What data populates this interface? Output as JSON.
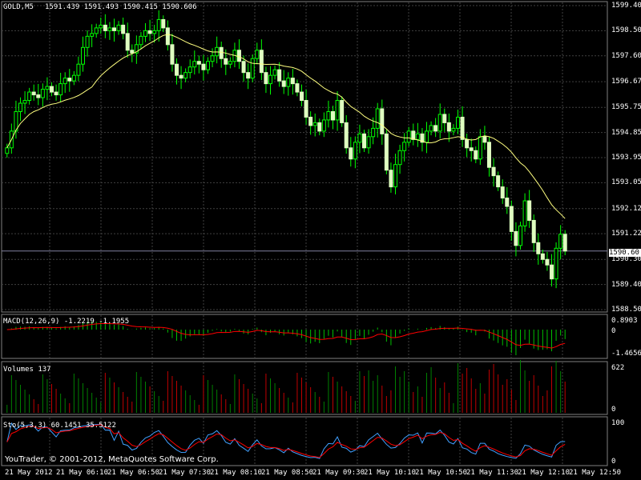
{
  "chart": {
    "symbol_header": "GOLD,M5",
    "ohlc_header": "1591.439 1591.493 1590.415 1590.606",
    "current_price_label": "1590.60",
    "price_axis_labels": [
      "1599.40",
      "1598.50",
      "1597.60",
      "1596.67",
      "1595.75",
      "1594.85",
      "1593.95",
      "1593.05",
      "1592.12",
      "1591.22",
      "1590.30",
      "1589.40",
      "1588.50"
    ],
    "time_axis_labels": [
      "21 May 2012",
      "21 May 06:10",
      "21 May 06:50",
      "21 May 07:30",
      "21 May 08:10",
      "21 May 08:50",
      "21 May 09:30",
      "21 May 10:10",
      "21 May 10:50",
      "21 May 11:30",
      "21 May 12:10",
      "21 May 12:50"
    ],
    "colors": {
      "background": "#000000",
      "grid": "#404040",
      "bull": "#00ff00",
      "bear": "#dfffc0",
      "ma": "#ffff80",
      "macd_hist": "#00c000",
      "macd_signal": "#ff0000",
      "vol_up": "#008000",
      "vol_down": "#c00000",
      "stoch_main": "#40a0ff",
      "stoch_signal": "#ff0000"
    },
    "copyright": "YouTrader, © 2001-2012, MetaQuotes Software Corp."
  },
  "macd": {
    "title": "MACD(12,26,9) -1.2219 -1.1955",
    "max_label": "0.8903",
    "zero_label": "0",
    "min_label": "-1.4656"
  },
  "volumes": {
    "title": "Volumes 137",
    "max_label": "622",
    "min_label": "0"
  },
  "stochastic": {
    "title": "Sto(5,3,3) 60.1451 35.5122",
    "max_label": "100",
    "min_label": "0"
  },
  "chart_data": {
    "type": "candlestick",
    "closes": [
      1594.3,
      1594.9,
      1595.6,
      1595.9,
      1596.0,
      1596.3,
      1596.2,
      1596.1,
      1596.4,
      1596.5,
      1596.3,
      1596.2,
      1596.6,
      1596.8,
      1596.7,
      1596.9,
      1597.3,
      1597.9,
      1598.3,
      1598.4,
      1598.6,
      1598.7,
      1598.5,
      1598.6,
      1598.5,
      1598.7,
      1598.4,
      1597.8,
      1597.7,
      1598.0,
      1598.3,
      1598.5,
      1598.4,
      1598.5,
      1598.9,
      1598.6,
      1598.0,
      1597.3,
      1596.9,
      1596.8,
      1597.0,
      1597.2,
      1597.4,
      1597.3,
      1597.1,
      1597.4,
      1597.6,
      1597.9,
      1597.5,
      1597.3,
      1597.4,
      1597.8,
      1597.4,
      1597.0,
      1596.8,
      1597.5,
      1597.8,
      1597.0,
      1596.6,
      1596.9,
      1597.1,
      1596.7,
      1596.5,
      1596.8,
      1596.6,
      1596.3,
      1596.0,
      1595.4,
      1595.1,
      1595.2,
      1594.9,
      1595.3,
      1595.6,
      1595.3,
      1596.0,
      1595.2,
      1594.3,
      1593.9,
      1594.5,
      1594.8,
      1594.3,
      1594.7,
      1595.0,
      1595.7,
      1594.8,
      1593.5,
      1592.9,
      1593.7,
      1594.2,
      1594.5,
      1594.9,
      1594.6,
      1594.8,
      1594.5,
      1594.9,
      1595.1,
      1594.9,
      1595.5,
      1595.2,
      1594.9,
      1595.0,
      1595.4,
      1594.6,
      1594.3,
      1594.2,
      1593.9,
      1594.7,
      1594.5,
      1593.6,
      1593.3,
      1592.9,
      1592.5,
      1592.2,
      1591.3,
      1590.8,
      1591.5,
      1592.4,
      1591.7,
      1590.9,
      1590.5,
      1590.3,
      1590.1,
      1589.6,
      1590.7,
      1591.2,
      1590.6
    ],
    "ma_period": "20",
    "price_range": [
      1588.5,
      1599.4
    ]
  }
}
